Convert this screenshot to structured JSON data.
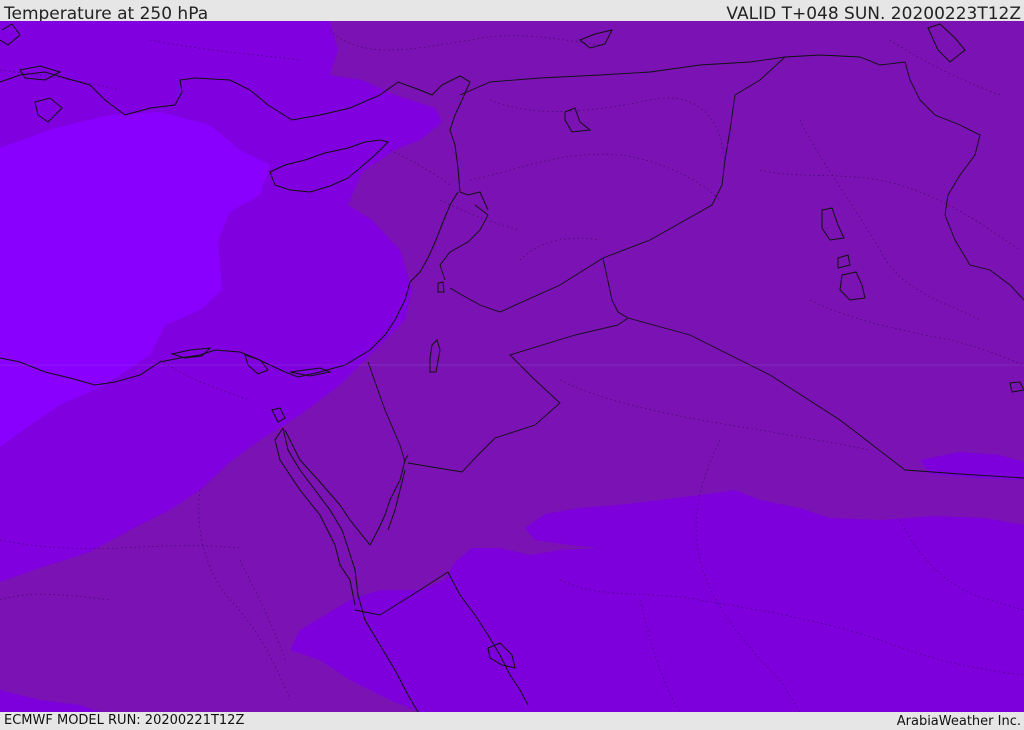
{
  "header": {
    "title": "Temperature at 250 hPa",
    "valid": "VALID T+048 SUN. 20200223T12Z"
  },
  "footer": {
    "model_run": "ECMWF MODEL RUN: 20200221T12Z",
    "credit": "ArabiaWeather Inc."
  },
  "colors": {
    "warm_band": "#7a12b4",
    "mid_band": "#8000df",
    "cold_band": "#8a00ff",
    "south_band": "#7d00dc",
    "coast_line": "#111111"
  }
}
